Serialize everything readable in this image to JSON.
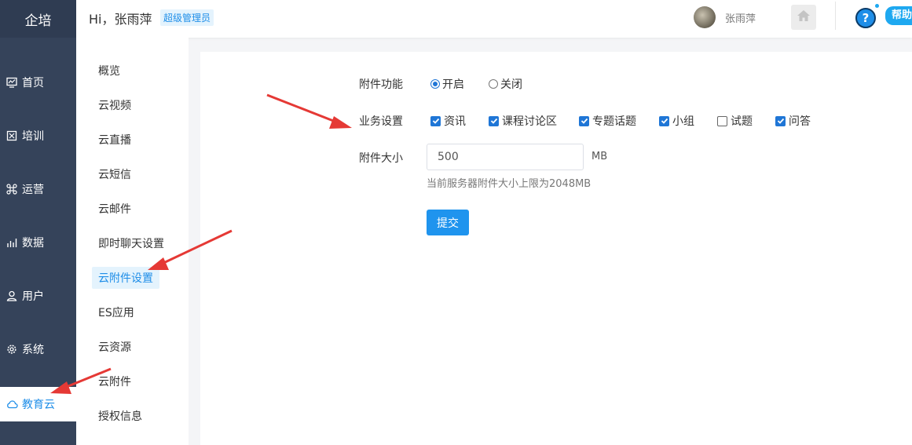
{
  "sidebar": {
    "logo": "企培",
    "items": [
      {
        "label": "首页",
        "icon": "dashboard-icon"
      },
      {
        "label": "培训",
        "icon": "book-icon"
      },
      {
        "label": "运营",
        "icon": "command-icon"
      },
      {
        "label": "数据",
        "icon": "bar-chart-icon"
      },
      {
        "label": "用户",
        "icon": "user-icon"
      },
      {
        "label": "系统",
        "icon": "gear-icon"
      },
      {
        "label": "教育云",
        "icon": "cloud-icon",
        "active": true
      }
    ]
  },
  "header": {
    "greeting": "Hi，张雨萍",
    "role_badge": "超级管理员",
    "username": "张雨萍",
    "help_label": "帮助"
  },
  "submenu": {
    "items": [
      {
        "label": "概览"
      },
      {
        "label": "云视频"
      },
      {
        "label": "云直播"
      },
      {
        "label": "云短信"
      },
      {
        "label": "云邮件"
      },
      {
        "label": "即时聊天设置"
      },
      {
        "label": "云附件设置",
        "active": true
      },
      {
        "label": "ES应用"
      },
      {
        "label": "云资源"
      },
      {
        "label": "云附件"
      },
      {
        "label": "授权信息"
      }
    ]
  },
  "form": {
    "attachment_feature": {
      "label": "附件功能",
      "options": [
        {
          "label": "开启",
          "selected": true
        },
        {
          "label": "关闭",
          "selected": false
        }
      ]
    },
    "business_settings": {
      "label": "业务设置",
      "options": [
        {
          "label": "资讯",
          "checked": true
        },
        {
          "label": "课程讨论区",
          "checked": true
        },
        {
          "label": "专题话题",
          "checked": true
        },
        {
          "label": "小组",
          "checked": true
        },
        {
          "label": "试题",
          "checked": false
        },
        {
          "label": "问答",
          "checked": true
        }
      ]
    },
    "attachment_size": {
      "label": "附件大小",
      "value": "500",
      "unit": "MB",
      "hint": "当前服务器附件大小上限为2048MB"
    },
    "submit_label": "提交"
  },
  "colors": {
    "sidebar_bg": "#35435a",
    "accent": "#1f8ee8",
    "annotation_arrow": "#e53935"
  }
}
